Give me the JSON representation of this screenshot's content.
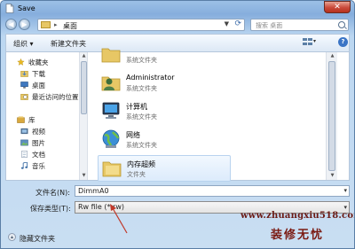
{
  "window": {
    "title": "Save",
    "close_glyph": "✕"
  },
  "address": {
    "path_separator": "▸",
    "path": "桌面",
    "search_placeholder": "搜索 桌面"
  },
  "toolbar": {
    "organize_label": "组织 ▾",
    "new_folder_label": "新建文件夹",
    "help_label": "?"
  },
  "nav": {
    "items": [
      {
        "label": "收藏夹",
        "icon": "star-icon",
        "color": "#e8b923"
      },
      {
        "label": "下载",
        "icon": "download-folder-icon",
        "color": "#4a7fc1"
      },
      {
        "label": "桌面",
        "icon": "desktop-icon",
        "color": "#3f78c0"
      },
      {
        "label": "最近访问的位置",
        "icon": "recent-places-icon",
        "color": "#7a8da6"
      },
      {
        "label": "库",
        "icon": "library-icon",
        "color": "#d9a93e"
      },
      {
        "label": "视频",
        "icon": "video-library-icon",
        "color": "#4b6b8e"
      },
      {
        "label": "图片",
        "icon": "pictures-library-icon",
        "color": "#5d8fbe"
      },
      {
        "label": "文档",
        "icon": "documents-library-icon",
        "color": "#8fa7c0"
      },
      {
        "label": "音乐",
        "icon": "music-library-icon",
        "color": "#3c6da4"
      }
    ]
  },
  "files": [
    {
      "name": "",
      "type": "系统文件夹",
      "icon": "partial-folder-icon"
    },
    {
      "name": "Administrator",
      "type": "系统文件夹",
      "icon": "user-folder-icon"
    },
    {
      "name": "计算机",
      "type": "系统文件夹",
      "icon": "computer-icon"
    },
    {
      "name": "网络",
      "type": "系统文件夹",
      "icon": "network-globe-icon"
    },
    {
      "name": "内存超频",
      "type": "文件夹",
      "icon": "folder-icon"
    }
  ],
  "form": {
    "filename_label": "文件名(N):",
    "filename_value": "DimmA0",
    "filetype_label": "保存类型(T):",
    "filetype_value": "Rw file (*.rw)",
    "dropdown_glyph": "▾"
  },
  "footer": {
    "hide_folders_label": "隐藏文件夹",
    "toggle_glyph": "▴"
  },
  "watermark": {
    "url": "www.zhuangxiu518.com",
    "name": "装修无忧"
  },
  "colors": {
    "accent": "#3a74c5",
    "annotation_arrow": "#c0392b"
  }
}
